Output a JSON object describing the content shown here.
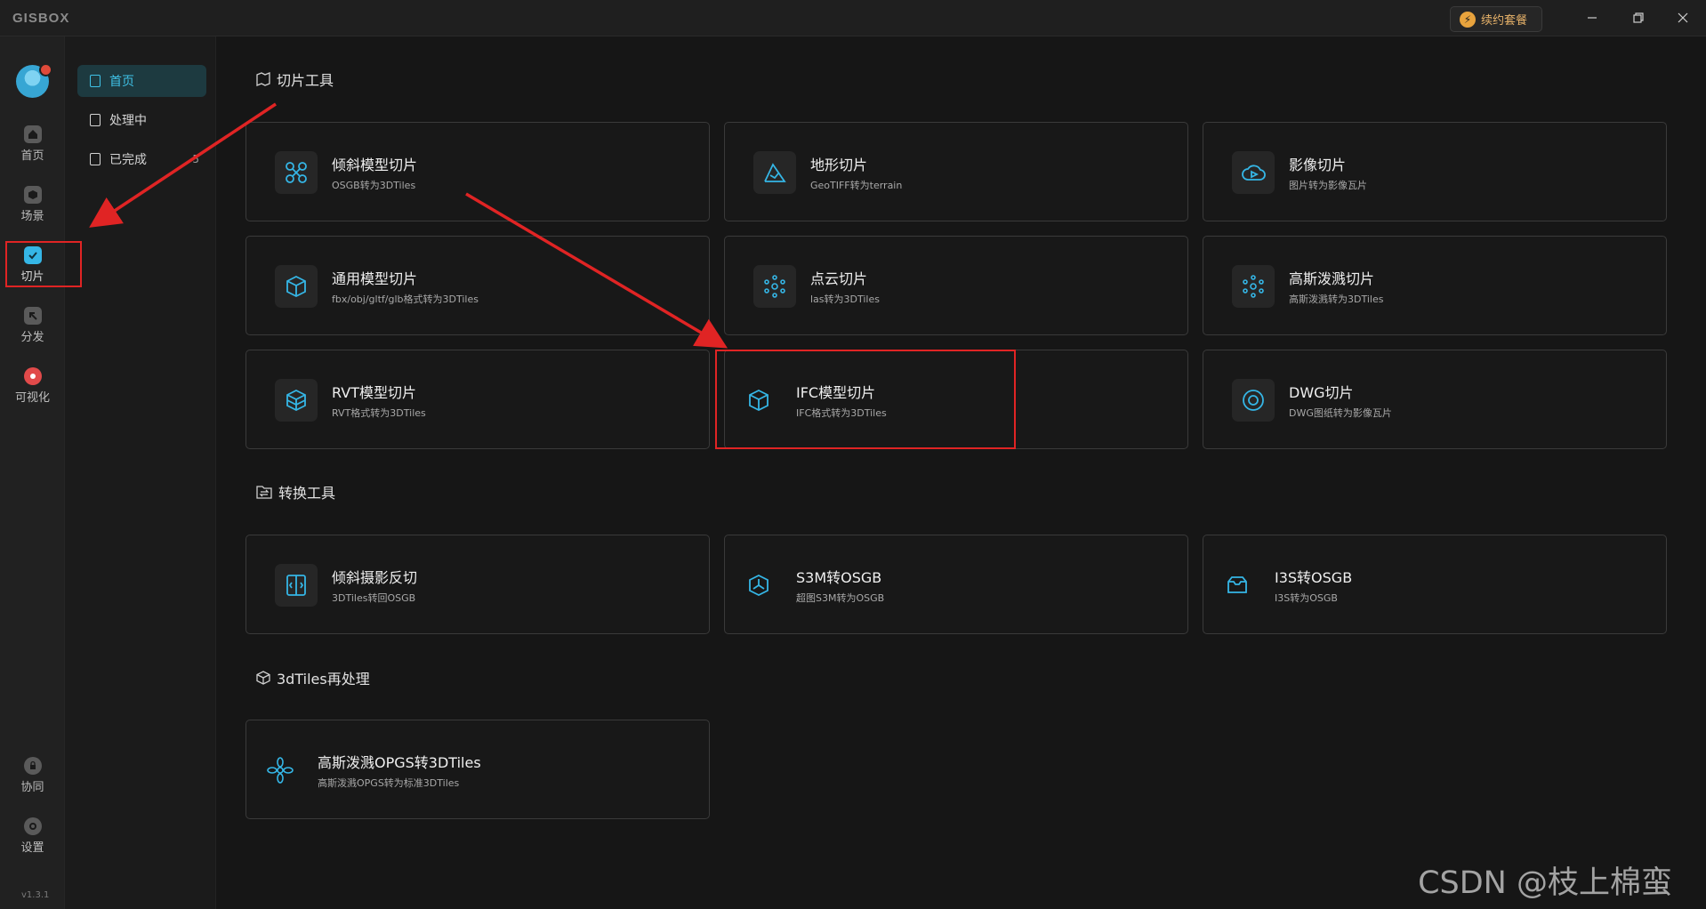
{
  "app": {
    "logo": "GISBOX",
    "version": "v1.3.1"
  },
  "titlebar": {
    "renew_label": "续约套餐"
  },
  "rail": {
    "items": [
      {
        "label": "首页"
      },
      {
        "label": "场景"
      },
      {
        "label": "切片"
      },
      {
        "label": "分发"
      },
      {
        "label": "可视化"
      },
      {
        "label": "协同"
      },
      {
        "label": "设置"
      }
    ]
  },
  "subnav": {
    "items": [
      {
        "label": "首页"
      },
      {
        "label": "处理中"
      },
      {
        "label": "已完成",
        "count": "5"
      }
    ]
  },
  "sections": [
    {
      "title": "切片工具",
      "cards": [
        {
          "title": "倾斜模型切片",
          "desc": "OSGB转为3DTiles",
          "icon": "drone-icon"
        },
        {
          "title": "地形切片",
          "desc": "GeoTIFF转为terrain",
          "icon": "terrain-icon"
        },
        {
          "title": "影像切片",
          "desc": "图片转为影像瓦片",
          "icon": "cloud-play-icon"
        },
        {
          "title": "通用模型切片",
          "desc": "fbx/obj/gltf/glb格式转为3DTiles",
          "icon": "cube-icon"
        },
        {
          "title": "点云切片",
          "desc": "las转为3DTiles",
          "icon": "point-cloud-icon"
        },
        {
          "title": "高斯泼溅切片",
          "desc": "高斯泼溅转为3DTiles",
          "icon": "gaussian-icon"
        },
        {
          "title": "RVT模型切片",
          "desc": "RVT格式转为3DTiles",
          "icon": "layers-cube-icon"
        },
        {
          "title": "IFC模型切片",
          "desc": "IFC格式转为3DTiles",
          "icon": "box-icon"
        },
        {
          "title": "DWG切片",
          "desc": "DWG图纸转为影像瓦片",
          "icon": "target-icon"
        }
      ]
    },
    {
      "title": "转换工具",
      "cards": [
        {
          "title": "倾斜摄影反切",
          "desc": "3DTiles转回OSGB",
          "icon": "code-file-icon"
        },
        {
          "title": "S3M转OSGB",
          "desc": "超图S3M转为OSGB",
          "icon": "hexagon-icon"
        },
        {
          "title": "I3S转OSGB",
          "desc": "I3S转为OSGB",
          "icon": "tray-icon"
        }
      ]
    },
    {
      "title": "3dTiles再处理",
      "cards": [
        {
          "title": "高斯泼溅OPGS转3DTiles",
          "desc": "高斯泼溅OPGS转为标准3DTiles",
          "icon": "flower-icon"
        }
      ]
    }
  ],
  "watermark": "CSDN @枝上棉蛮",
  "colors": {
    "accent": "#35b6e6",
    "annotation": "#e02424",
    "background": "#161616"
  }
}
